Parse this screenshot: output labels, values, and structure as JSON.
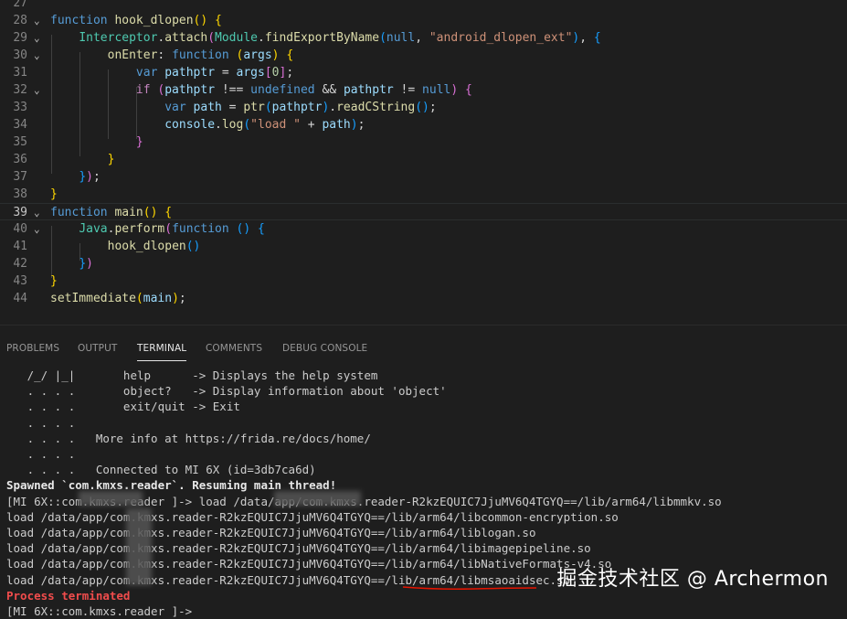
{
  "editor": {
    "lines": [
      {
        "num": "27",
        "tokens": []
      },
      {
        "num": "28",
        "fold": "⌄",
        "tokens": [
          [
            "kw",
            "function "
          ],
          [
            "fn",
            "hook_dlopen"
          ],
          [
            "b1",
            "() {"
          ]
        ]
      },
      {
        "num": "29",
        "fold": "⌄",
        "tokens": [
          [
            "plain",
            "    "
          ],
          [
            "cls",
            "Interceptor"
          ],
          [
            "plain",
            "."
          ],
          [
            "fn",
            "attach"
          ],
          [
            "b2",
            "("
          ],
          [
            "cls",
            "Module"
          ],
          [
            "plain",
            "."
          ],
          [
            "fn",
            "findExportByName"
          ],
          [
            "b3",
            "("
          ],
          [
            "kw",
            "null"
          ],
          [
            "plain",
            ", "
          ],
          [
            "str",
            "\"android_dlopen_ext\""
          ],
          [
            "b3",
            ")"
          ],
          [
            "plain",
            ", "
          ],
          [
            "b3",
            "{"
          ]
        ]
      },
      {
        "num": "30",
        "fold": "⌄",
        "tokens": [
          [
            "plain",
            "        "
          ],
          [
            "fn",
            "onEnter"
          ],
          [
            "plain",
            ": "
          ],
          [
            "kw",
            "function "
          ],
          [
            "b1",
            "("
          ],
          [
            "var",
            "args"
          ],
          [
            "b1",
            ") {"
          ]
        ]
      },
      {
        "num": "31",
        "tokens": [
          [
            "plain",
            "            "
          ],
          [
            "kw",
            "var "
          ],
          [
            "var",
            "pathptr"
          ],
          [
            "plain",
            " = "
          ],
          [
            "var",
            "args"
          ],
          [
            "b2",
            "["
          ],
          [
            "num",
            "0"
          ],
          [
            "b2",
            "]"
          ],
          [
            "plain",
            ";"
          ]
        ]
      },
      {
        "num": "32",
        "fold": "⌄",
        "tokens": [
          [
            "plain",
            "            "
          ],
          [
            "ctl",
            "if "
          ],
          [
            "b2",
            "("
          ],
          [
            "var",
            "pathptr"
          ],
          [
            "plain",
            " !== "
          ],
          [
            "kw",
            "undefined"
          ],
          [
            "plain",
            " && "
          ],
          [
            "var",
            "pathptr"
          ],
          [
            "plain",
            " != "
          ],
          [
            "kw",
            "null"
          ],
          [
            "b2",
            ") {"
          ]
        ]
      },
      {
        "num": "33",
        "tokens": [
          [
            "plain",
            "                "
          ],
          [
            "kw",
            "var "
          ],
          [
            "var",
            "path"
          ],
          [
            "plain",
            " = "
          ],
          [
            "fn",
            "ptr"
          ],
          [
            "b3",
            "("
          ],
          [
            "var",
            "pathptr"
          ],
          [
            "b3",
            ")"
          ],
          [
            "plain",
            "."
          ],
          [
            "fn",
            "readCString"
          ],
          [
            "b3",
            "()"
          ],
          [
            "plain",
            ";"
          ]
        ]
      },
      {
        "num": "34",
        "tokens": [
          [
            "plain",
            "                "
          ],
          [
            "var",
            "console"
          ],
          [
            "plain",
            "."
          ],
          [
            "fn",
            "log"
          ],
          [
            "b3",
            "("
          ],
          [
            "str",
            "\"load \""
          ],
          [
            "plain",
            " + "
          ],
          [
            "var",
            "path"
          ],
          [
            "b3",
            ")"
          ],
          [
            "plain",
            ";"
          ]
        ]
      },
      {
        "num": "35",
        "tokens": [
          [
            "plain",
            "            "
          ],
          [
            "b2",
            "}"
          ]
        ]
      },
      {
        "num": "36",
        "tokens": [
          [
            "plain",
            "        "
          ],
          [
            "b1",
            "}"
          ]
        ]
      },
      {
        "num": "37",
        "tokens": [
          [
            "plain",
            "    "
          ],
          [
            "b3",
            "}"
          ],
          [
            "b2",
            ")"
          ],
          [
            "plain",
            ";"
          ]
        ]
      },
      {
        "num": "38",
        "tokens": [
          [
            "b1",
            "}"
          ]
        ]
      },
      {
        "num": "39",
        "fold": "⌄",
        "current": true,
        "tokens": [
          [
            "kw",
            "function "
          ],
          [
            "fn",
            "main"
          ],
          [
            "b1",
            "() {"
          ]
        ]
      },
      {
        "num": "40",
        "fold": "⌄",
        "tokens": [
          [
            "plain",
            "    "
          ],
          [
            "cls",
            "Java"
          ],
          [
            "plain",
            "."
          ],
          [
            "fn",
            "perform"
          ],
          [
            "b2",
            "("
          ],
          [
            "kw",
            "function "
          ],
          [
            "b3",
            "() {"
          ]
        ]
      },
      {
        "num": "41",
        "tokens": [
          [
            "plain",
            "        "
          ],
          [
            "fn",
            "hook_dlopen"
          ],
          [
            "b3",
            "()"
          ]
        ]
      },
      {
        "num": "42",
        "tokens": [
          [
            "plain",
            "    "
          ],
          [
            "b3",
            "}"
          ],
          [
            "b2",
            ")"
          ]
        ]
      },
      {
        "num": "43",
        "tokens": [
          [
            "b1",
            "}"
          ]
        ]
      },
      {
        "num": "44",
        "tokens": [
          [
            "fn",
            "setImmediate"
          ],
          [
            "b1",
            "("
          ],
          [
            "var",
            "main"
          ],
          [
            "b1",
            ")"
          ],
          [
            "plain",
            ";"
          ]
        ]
      }
    ]
  },
  "panel": {
    "tabs": [
      "PROBLEMS",
      "OUTPUT",
      "TERMINAL",
      "COMMENTS",
      "DEBUG CONSOLE"
    ],
    "active_tab": "TERMINAL"
  },
  "terminal": {
    "lines": [
      {
        "text": "   /_/ |_|       help      -> Displays the help system",
        "style": ""
      },
      {
        "text": "   . . . .       object?   -> Display information about 'object'",
        "style": ""
      },
      {
        "text": "   . . . .       exit/quit -> Exit",
        "style": ""
      },
      {
        "text": "   . . . .",
        "style": ""
      },
      {
        "text": "   . . . .   More info at https://frida.re/docs/home/",
        "style": ""
      },
      {
        "text": "   . . . .",
        "style": ""
      },
      {
        "text": "   . . . .   Connected to MI 6X (id=3db7ca6d)",
        "style": ""
      },
      {
        "text": "Spawned `com.kmxs.reader`. Resuming main thread!",
        "style": "bold"
      },
      {
        "text": "[MI 6X::com.kmxs.reader ]-> load /data/app/com.kmxs.reader-R2kzEQUIC7JjuMV6Q4TGYQ==/lib/arm64/libmmkv.so",
        "style": ""
      },
      {
        "text": "load /data/app/com.kmxs.reader-R2kzEQUIC7JjuMV6Q4TGYQ==/lib/arm64/libcommon-encryption.so",
        "style": ""
      },
      {
        "text": "load /data/app/com.kmxs.reader-R2kzEQUIC7JjuMV6Q4TGYQ==/lib/arm64/liblogan.so",
        "style": ""
      },
      {
        "text": "load /data/app/com.kmxs.reader-R2kzEQUIC7JjuMV6Q4TGYQ==/lib/arm64/libimagepipeline.so",
        "style": ""
      },
      {
        "text": "load /data/app/com.kmxs.reader-R2kzEQUIC7JjuMV6Q4TGYQ==/lib/arm64/libNativeFormats-v4.so",
        "style": ""
      },
      {
        "text": "load /data/app/com.kmxs.reader-R2kzEQUIC7JjuMV6Q4TGYQ==/lib/arm64/libmsaoaidsec.so",
        "style": ""
      },
      {
        "text": "Process terminated",
        "style": "red"
      },
      {
        "text": "[MI 6X::com.kmxs.reader ]->",
        "style": ""
      }
    ]
  },
  "watermark": "掘金技术社区 @ Archermon",
  "colors": {
    "background": "#1e1e1e",
    "accent_underline": "#e51400",
    "error": "#f14c4c"
  }
}
